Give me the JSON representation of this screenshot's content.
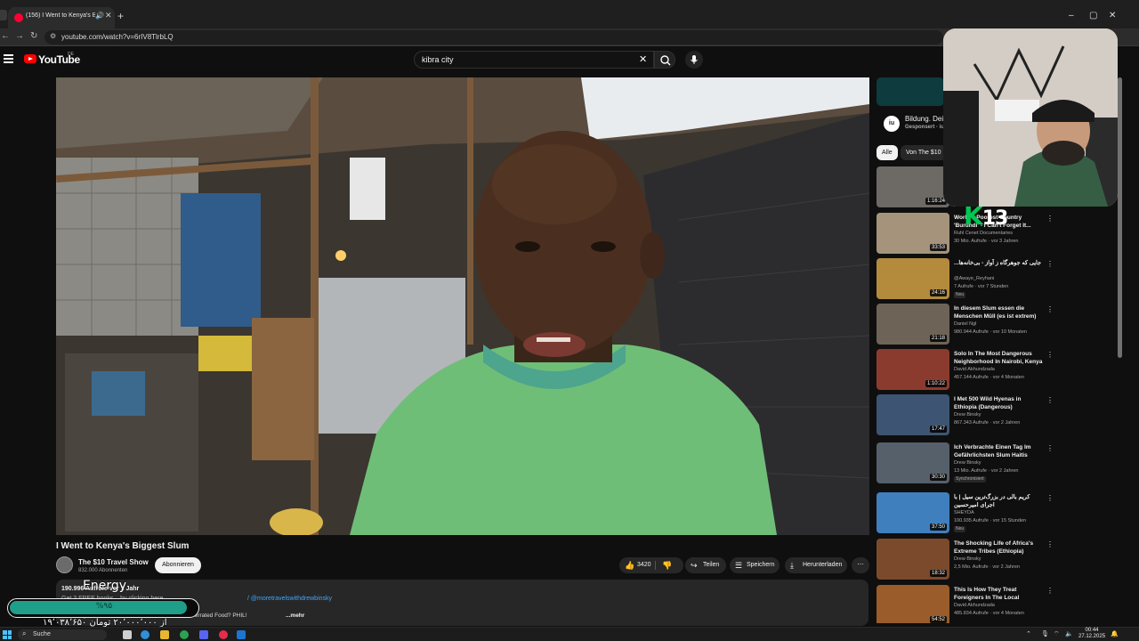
{
  "browser": {
    "tab_title": "(156) I Went to Kenya's Big",
    "new_tab_icon": "plus-icon",
    "window_controls": [
      "–",
      "▢",
      "✕"
    ],
    "url": "youtube.com/watch?v=6rIV8TlrbLQ"
  },
  "youtube": {
    "logo_text": "YouTube",
    "country_code": "DE",
    "search_value": "kibra city"
  },
  "video": {
    "title": "I Went to Kenya's Biggest Slum",
    "channel_name": "The $10 Travel Show",
    "subscribers": "832.000 Abonnenten",
    "subscribe_label": "Abonnieren",
    "likes": "3420",
    "share_label": "Teilen",
    "save_label": "Speichern",
    "download_label": "Herunterladen",
    "more_actions": "⋯",
    "description": {
      "meta": "190.996 Aufrufe  vor 1 Jahr",
      "line2": "Get 3 FREE books... by clicking here → ",
      "link": "/ @moretravelswithdrewbinsky",
      "line3": "Watch my favorite videos →  Is This Asia's Most Underrated Food? PHIL!",
      "more": "...mehr"
    }
  },
  "sidebar": {
    "ad": {
      "badge": "iu",
      "title": "Bildung. Dei",
      "sponsored": "Gesponsert · iu"
    },
    "chips": [
      "Alle",
      "Von The $10"
    ],
    "videos": [
      {
        "title": "",
        "channel": "",
        "meta": "",
        "duration": "1:16:24",
        "badge": "",
        "thumb": "#6d6a66"
      },
      {
        "title": "World's Poorest Country 'Burundi' - I Can't Forget It...",
        "channel": "Ruhl Cenet Documentaries",
        "meta": "30 Mio. Aufrufe · vor 3 Jahren",
        "duration": "33:53",
        "badge": "",
        "thumb": "#a5937b"
      },
      {
        "title": "...جایی که جوهرگاه ز آواز - بی‌خانه‌ها",
        "channel": "@Awaye_Reyhani",
        "meta": "7 Aufrufe · vor 7 Stunden",
        "duration": "24:16",
        "badge": "Neu",
        "thumb": "#b48a3d"
      },
      {
        "title": "In diesem Slum essen die Menschen Müll (es ist extrem)",
        "channel": "Daniel Ngl",
        "meta": "980.944 Aufrufe · vor 10 Monaten",
        "duration": "21:18",
        "badge": "",
        "thumb": "#6e6357"
      },
      {
        "title": "Solo In The Most Dangerous Neighborhood In Nairobi, Kenya",
        "channel": "David Akhundzada",
        "meta": "457.144 Aufrufe · vor 4 Monaten",
        "duration": "1:10:22",
        "badge": "",
        "thumb": "#8b3b2e"
      },
      {
        "title": "I Met 500 Wild Hyenas in Ethiopia (Dangerous)",
        "channel": "Drew Binsky",
        "meta": "867.343 Aufrufe · vor 2 Jahren",
        "duration": "17:47",
        "badge": "",
        "thumb": "#3d5572"
      },
      {
        "title": "Ich Verbrachte Einen Tag Im Gefährlichsten Slum Haitis",
        "channel": "Drew Binsky",
        "meta": "13 Mio. Aufrufe · vor 2 Jahren",
        "duration": "30:30",
        "badge": "Synchronisiert",
        "thumb": "#56606b"
      },
      {
        "title": "کریم بالی در بزرگ‌ترین سیل | با اجرای امیرحسین",
        "channel": "SHEYDA",
        "meta": "100.935 Aufrufe · vor 15 Stunden",
        "duration": "37:50",
        "badge": "Neu",
        "thumb": "#3f7fbe"
      },
      {
        "title": "The Shocking Life of Africa's Extreme Tribes (Ethiopia)",
        "channel": "Drew Binsky",
        "meta": "2,5 Mio. Aufrufe · vor 2 Jahren",
        "duration": "18:32",
        "badge": "",
        "thumb": "#7b4a2c"
      },
      {
        "title": "This Is How They Treat Foreigners In The Local Nairobi...",
        "channel": "David Akhundzada",
        "meta": "485.834 Aufrufe · vor 4 Monaten",
        "duration": "54:52",
        "badge": "",
        "thumb": "#9a5c2a"
      }
    ]
  },
  "overlay": {
    "k_letter": "K",
    "k_number": "13",
    "energy_label": "Energy",
    "energy_percent_text": "%۹۵",
    "energy_level": 0.95,
    "energy_fa_text": "۱۹٬۰۳۸٬۶۵۰ از ۲۰٬۰۰۰٬۰۰۰ تومان"
  },
  "taskbar": {
    "search_label": "Suche",
    "time": "00:44",
    "date": "27.12.2025"
  },
  "colors": {
    "background": "#0f0f0f",
    "youtube_red": "#ff0000",
    "energy_fill": "#1f9e8a",
    "k_green": "#00c853"
  }
}
